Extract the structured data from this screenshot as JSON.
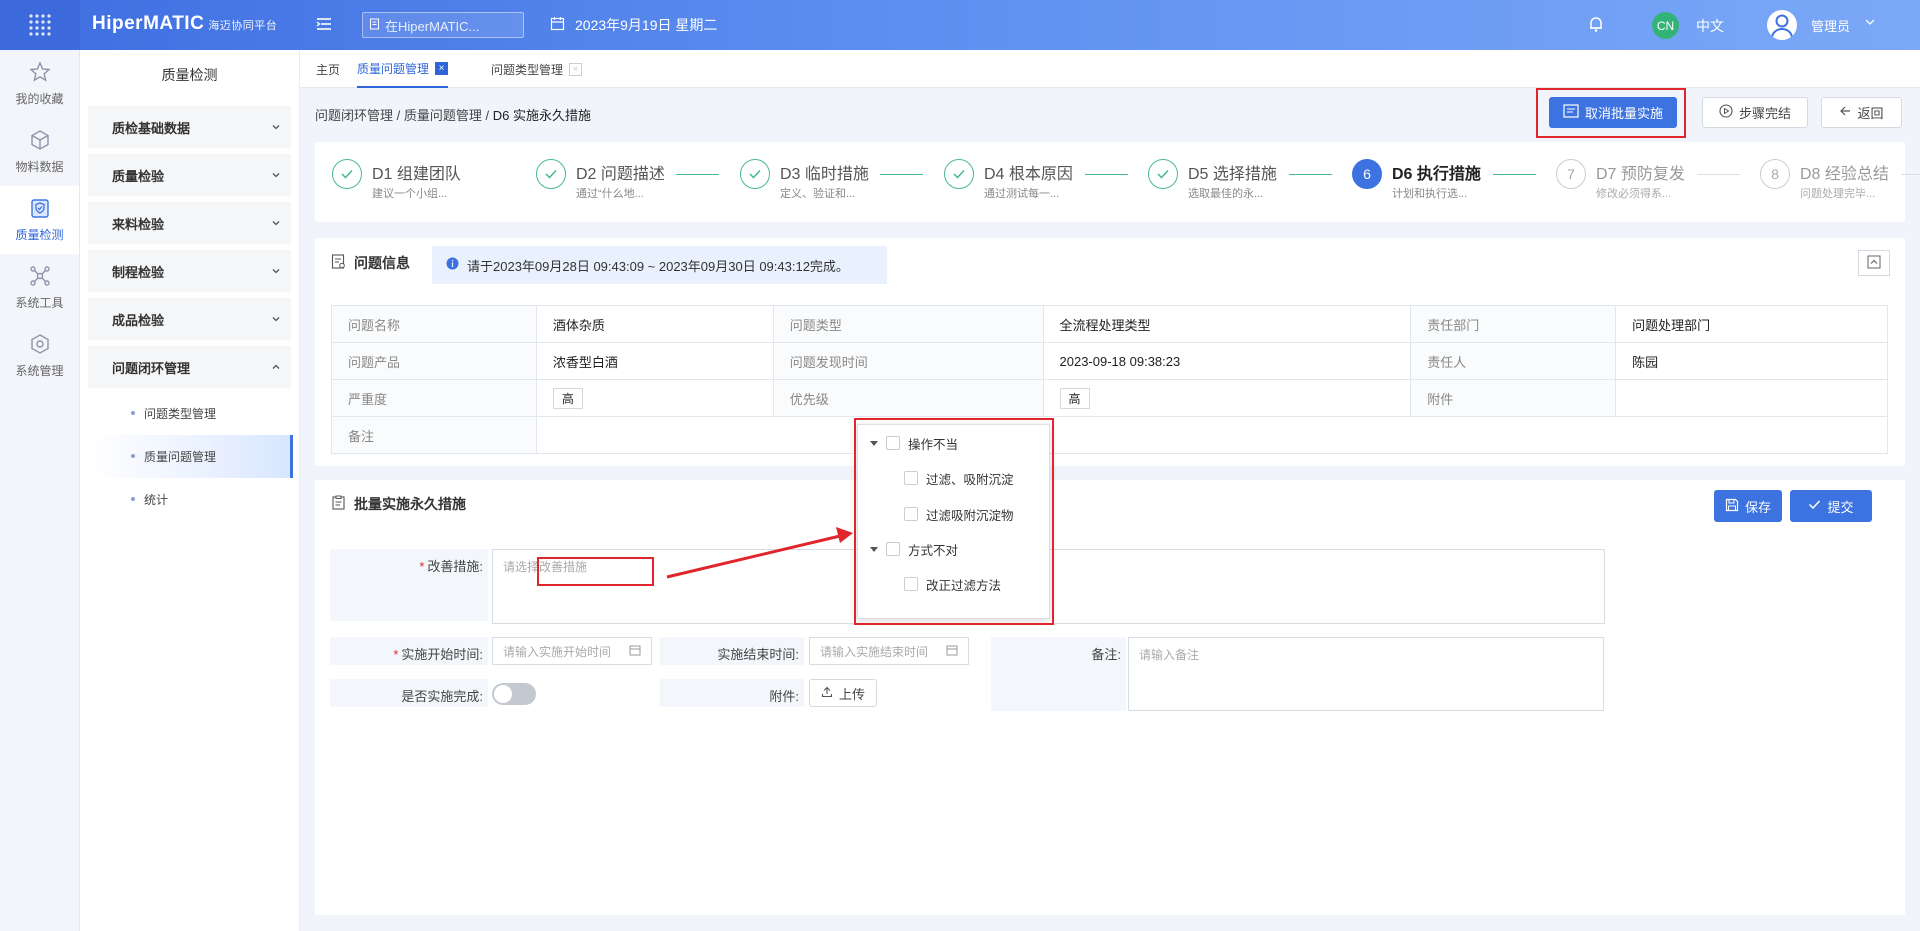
{
  "topbar": {
    "brand": "HiperMATIC",
    "brand_sub": "海迈协同平台",
    "search_placeholder": "在HiperMATIC...",
    "date": "2023年9月19日 星期二",
    "lang_code": "CN",
    "lang": "中文",
    "user": "管理员"
  },
  "rail": [
    {
      "label": "我的收藏",
      "icon": "star-icon"
    },
    {
      "label": "物料数据",
      "icon": "cube-icon"
    },
    {
      "label": "质量检测",
      "icon": "shield-icon"
    },
    {
      "label": "系统工具",
      "icon": "network-icon"
    },
    {
      "label": "系统管理",
      "icon": "gear-icon"
    }
  ],
  "sidebar": {
    "title": "质量检测",
    "groups": [
      "质检基础数据",
      "质量检验",
      "来料检验",
      "制程检验",
      "成品检验",
      "问题闭环管理"
    ],
    "subitems": [
      "问题类型管理",
      "质量问题管理",
      "统计"
    ]
  },
  "tabs": [
    {
      "label": "主页"
    },
    {
      "label": "质量问题管理"
    },
    {
      "label": "问题类型管理"
    }
  ],
  "breadcrumb": {
    "part1": "问题闭环管理",
    "part2": "质量问题管理",
    "part3": "D6 实施永久措施",
    "sep": "/"
  },
  "actions": {
    "cancel_batch": "取消批量实施",
    "step_done": "步骤完结",
    "back": "返回"
  },
  "steps": [
    {
      "num": "1",
      "title": "D1 组建团队",
      "desc": "建议一个小组..."
    },
    {
      "num": "2",
      "title": "D2 问题描述",
      "desc": "通过“什么地..."
    },
    {
      "num": "3",
      "title": "D3 临时措施",
      "desc": "定义、验证和..."
    },
    {
      "num": "4",
      "title": "D4 根本原因",
      "desc": "通过测试每一..."
    },
    {
      "num": "5",
      "title": "D5 选择措施",
      "desc": "选取最佳的永..."
    },
    {
      "num": "6",
      "title": "D6 执行措施",
      "desc": "计划和执行选..."
    },
    {
      "num": "7",
      "title": "D7 预防复发",
      "desc": "修改必须得系..."
    },
    {
      "num": "8",
      "title": "D8 经验总结",
      "desc": "问题处理完毕..."
    }
  ],
  "info": {
    "title": "问题信息",
    "notice": "请于2023年09月28日 09:43:09 ~ 2023年09月30日 09:43:12完成。",
    "rows": [
      [
        "问题名称",
        "酒体杂质",
        "问题类型",
        "全流程处理类型",
        "责任部门",
        "问题处理部门"
      ],
      [
        "问题产品",
        "浓香型白酒",
        "问题发现时间",
        "2023-09-18 09:38:23",
        "责任人",
        "陈园"
      ],
      [
        "严重度",
        "高",
        "优先级",
        "高",
        "附件",
        ""
      ],
      [
        "备注",
        "",
        "",
        "",
        "",
        ""
      ]
    ]
  },
  "batch": {
    "title": "批量实施永久措施",
    "save": "保存",
    "submit": "提交",
    "improve_label": "改善措施:",
    "improve_placeholder": "请选择改善措施",
    "start_label": "实施开始时间:",
    "start_placeholder": "请输入实施开始时间",
    "end_label": "实施结束时间:",
    "end_placeholder": "请输入实施结束时间",
    "remark_label": "备注:",
    "remark_placeholder": "请输入备注",
    "done_label": "是否实施完成:",
    "done_value": false,
    "attach_label": "附件:",
    "upload": "上传"
  },
  "dropdown": {
    "groups": [
      {
        "label": "操作不当",
        "children": [
          "过滤、吸附沉淀",
          "过滤吸附沉淀物"
        ]
      },
      {
        "label": "方式不对",
        "children": [
          "改正过滤方法"
        ]
      }
    ]
  },
  "colors": {
    "primary": "#3d73e0",
    "highlight": "#e0252c",
    "done": "#48b88f"
  }
}
